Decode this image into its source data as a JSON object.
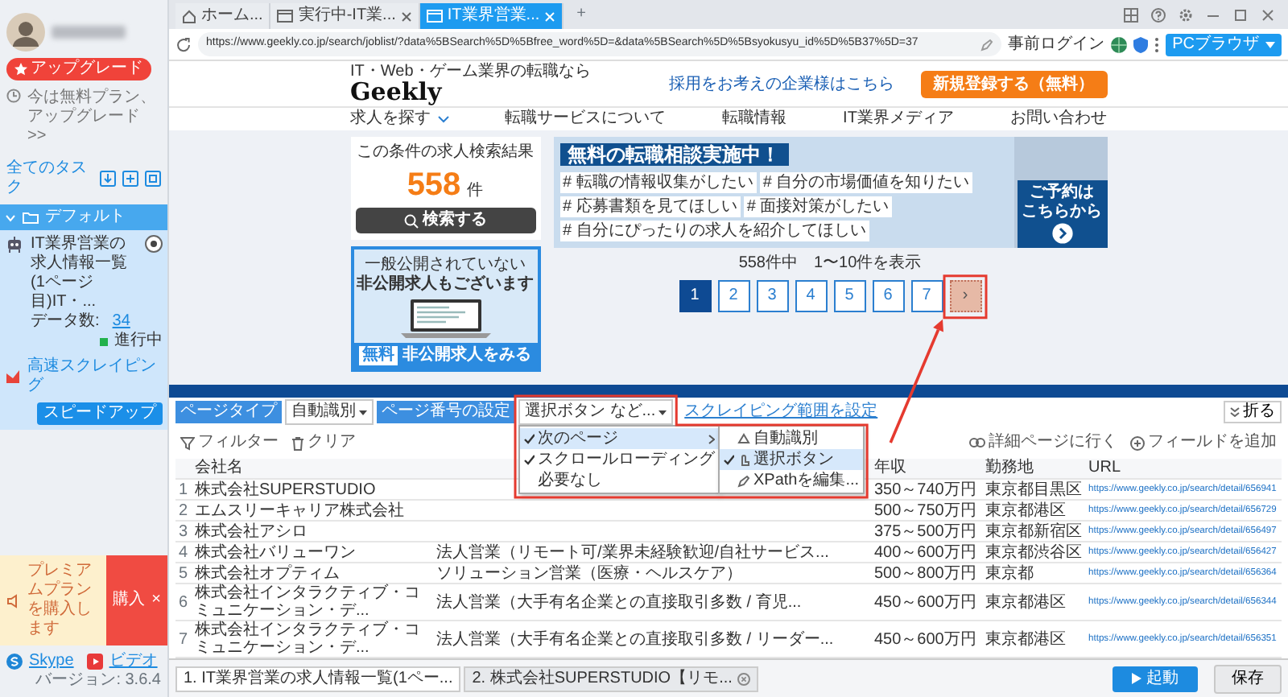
{
  "sidebar": {
    "upgrade_badge": "アップグレード",
    "plan_link": "今は無料プラン、アップグレード >>",
    "all_tasks": "全てのタスク",
    "groups": [
      {
        "name": "デフォルト",
        "expanded": true,
        "tasks": [
          {
            "title": "IT業界営業の求人情報一覧(1ページ目)IT・...",
            "count_label": "データ数: ",
            "count": "34",
            "status": "進行中",
            "mode": "高速スクレイピング",
            "action": "スピードアップ"
          }
        ]
      }
    ],
    "premium": {
      "text": "プレミアムプランを購入します",
      "button": "購入",
      "close": "×"
    },
    "links": [
      {
        "label": "Skype",
        "kind": "skype"
      },
      {
        "label": "ビデオ",
        "kind": "video"
      }
    ],
    "version": "バージョン: 3.6.4"
  },
  "browser": {
    "tabs": [
      {
        "label": "ホーム...",
        "kind": "home",
        "selected": false
      },
      {
        "label": "実行中-IT業...",
        "kind": "page",
        "selected": false
      },
      {
        "label": "IT業界営業...",
        "kind": "page",
        "selected": true
      }
    ],
    "new_tab": "+",
    "url": "https://www.geekly.co.jp/search/joblist/?data%5BSearch%5D%5Bfree_word%5D=&data%5BSearch%5D%5Bsyokusyu_id%5D%5B37%5D=37",
    "login": "事前ログイン",
    "mode_button": "PCブラウザ"
  },
  "webpage": {
    "tagline": "IT・Web・ゲーム業界の転職なら",
    "logo": "Geekly",
    "employer_link": "採用をお考えの企業様はこちら",
    "signup_button": "新規登録する（無料）",
    "nav": [
      {
        "label": "求人を探す",
        "dropdown": true
      },
      {
        "label": "転職サービスについて",
        "dropdown": false
      },
      {
        "label": "転職情報",
        "dropdown": false
      },
      {
        "label": "IT業界メディア",
        "dropdown": false
      },
      {
        "label": "お問い合わせ",
        "dropdown": false
      }
    ],
    "results_card": {
      "title": "この条件の求人検索結果",
      "count": "558",
      "unit": "件",
      "search_button": "検索する"
    },
    "hidden_jobs": {
      "line1": "一般公開されていない",
      "line2": "**非公開求人**もございます",
      "badge": "無料",
      "cta": "非公開求人をみる"
    },
    "consult_banner": {
      "title": "無料の転職相談実施中！",
      "tags": [
        "# 転職の情報収集がしたい",
        "# 自分の市場価値を知りたい",
        "# 応募書類を見てほしい",
        "# 面接対策がしたい",
        "# 自分にぴったりの求人を紹介してほしい"
      ],
      "reserve_line1": "ご予約は",
      "reserve_line2": "こちらから"
    },
    "summary": "558件中　1〜10件を表示",
    "pagination": [
      {
        "label": "1",
        "kind": "page",
        "selected": true
      },
      {
        "label": "2",
        "kind": "page",
        "selected": false
      },
      {
        "label": "3",
        "kind": "page",
        "selected": false
      },
      {
        "label": "4",
        "kind": "page",
        "selected": false
      },
      {
        "label": "5",
        "kind": "page",
        "selected": false
      },
      {
        "label": "6",
        "kind": "page",
        "selected": false
      },
      {
        "label": "7",
        "kind": "page",
        "selected": false
      },
      {
        "label": "›",
        "kind": "next",
        "highlighted": true
      }
    ]
  },
  "panel": {
    "collapse_button": "折る",
    "page_type": {
      "label": "ページタイプ",
      "value": "自動識別"
    },
    "page_number": {
      "label": "ページ番号の設定",
      "value": "選択ボタン など...",
      "open": true,
      "highlighted": true
    },
    "range_link": "スクレイピング範囲を設定",
    "tools": [
      {
        "label": "フィルター",
        "kind": "filter"
      },
      {
        "label": "クリア",
        "kind": "clear"
      },
      {
        "label": "詳細ページに行く",
        "kind": "detail"
      },
      {
        "label": "フィールドを追加",
        "kind": "add"
      }
    ],
    "menu": [
      {
        "label": "次のページ",
        "checked": true,
        "selected": true,
        "submenu": true
      },
      {
        "label": "スクロールローディング",
        "checked": true,
        "selected": false,
        "submenu": false
      },
      {
        "label": "必要なし",
        "checked": false,
        "selected": false,
        "submenu": false
      }
    ],
    "submenu": [
      {
        "label": "自動識別",
        "kind": "auto",
        "checked": false,
        "selected": false
      },
      {
        "label": "選択ボタン",
        "kind": "click",
        "checked": true,
        "selected": true
      },
      {
        "label": "XPathを編集...",
        "kind": "xpath",
        "checked": false,
        "selected": false
      }
    ],
    "headers": {
      "company": "会社名",
      "salary": "年収",
      "location": "勤務地",
      "url": "URL"
    },
    "rows": [
      {
        "no": "1",
        "company": "株式会社SUPERSTUDIO",
        "salary": "350～740万円",
        "location": "東京都目黒区",
        "url": "https://www.geekly.co.jp/search/detail/656941"
      },
      {
        "no": "2",
        "company": "エムスリーキャリア株式会社",
        "salary": "500～750万円",
        "location": "東京都港区",
        "url": "https://www.geekly.co.jp/search/detail/656729"
      },
      {
        "no": "3",
        "company": "株式会社アシロ",
        "salary": "375～500万円",
        "location": "東京都新宿区",
        "url": "https://www.geekly.co.jp/search/detail/656497"
      },
      {
        "no": "4",
        "company": "株式会社バリューワン",
        "column_3": "法人営業（リモート可/業界未経験歓迎/自社サービス...",
        "salary": "400～600万円",
        "location": "東京都渋谷区",
        "url": "https://www.geekly.co.jp/search/detail/656427"
      },
      {
        "no": "5",
        "company": "株式会社オプティム",
        "column_3": "ソリューション営業（医療・ヘルスケア）",
        "salary": "500～800万円",
        "location": "東京都",
        "url": "https://www.geekly.co.jp/search/detail/656364"
      },
      {
        "no": "6",
        "company": "株式会社インタラクティブ・コミュニケーション・デ...",
        "column_3": "法人営業（大手有名企業との直接取引多数 / 育児...",
        "salary": "450～600万円",
        "location": "東京都港区",
        "url": "https://www.geekly.co.jp/search/detail/656344"
      },
      {
        "no": "7",
        "company": "株式会社インタラクティブ・コミュニケーション・デ...",
        "column_3": "法人営業（大手有名企業との直接取引多数 / リーダー...",
        "salary": "450～600万円",
        "location": "東京都港区",
        "url": "https://www.geekly.co.jp/search/detail/656351"
      }
    ],
    "task_tabs": [
      {
        "label": "1. IT業界営業の求人情報一覧(1ペー...",
        "selected": true,
        "closable": false
      },
      {
        "label": "2. 株式会社SUPERSTUDIO【リモ...",
        "selected": false,
        "closable": true
      }
    ],
    "start_button": "起動",
    "save_button": "保存"
  }
}
